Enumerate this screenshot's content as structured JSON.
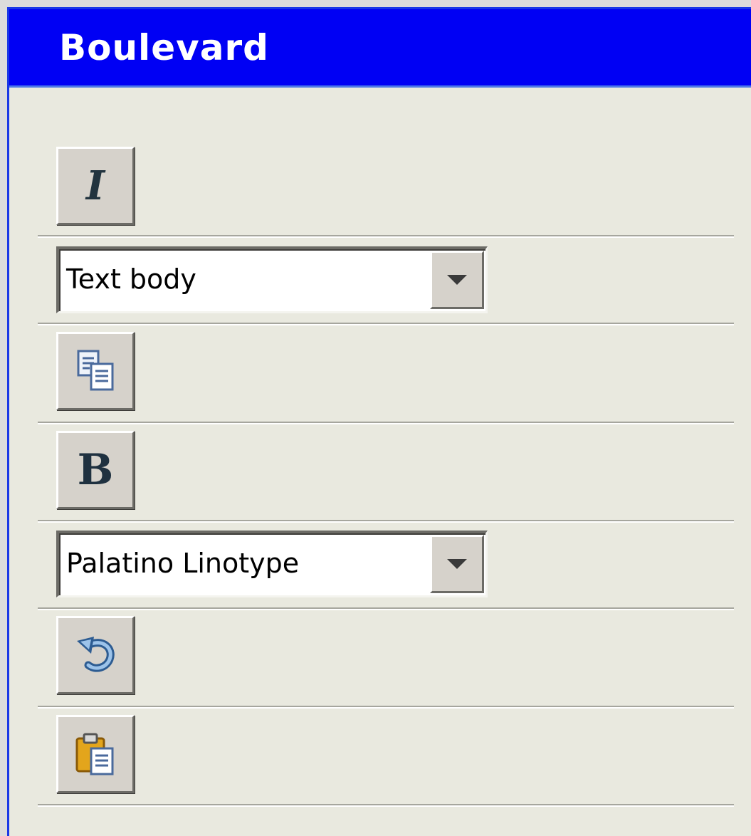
{
  "window": {
    "title": "Boulevard"
  },
  "toolbar": {
    "items": [
      {
        "kind": "button",
        "icon": "italic-icon",
        "glyph": "I"
      },
      {
        "kind": "combo",
        "value": "Text body"
      },
      {
        "kind": "button",
        "icon": "copy-icon"
      },
      {
        "kind": "button",
        "icon": "bold-icon",
        "glyph": "B"
      },
      {
        "kind": "combo",
        "value": "Palatino Linotype"
      },
      {
        "kind": "button",
        "icon": "undo-icon"
      },
      {
        "kind": "button",
        "icon": "paste-icon"
      }
    ]
  },
  "colors": {
    "titlebar": "#0000f4",
    "panel": "#e9e9df",
    "button_face": "#d6d2cb"
  }
}
